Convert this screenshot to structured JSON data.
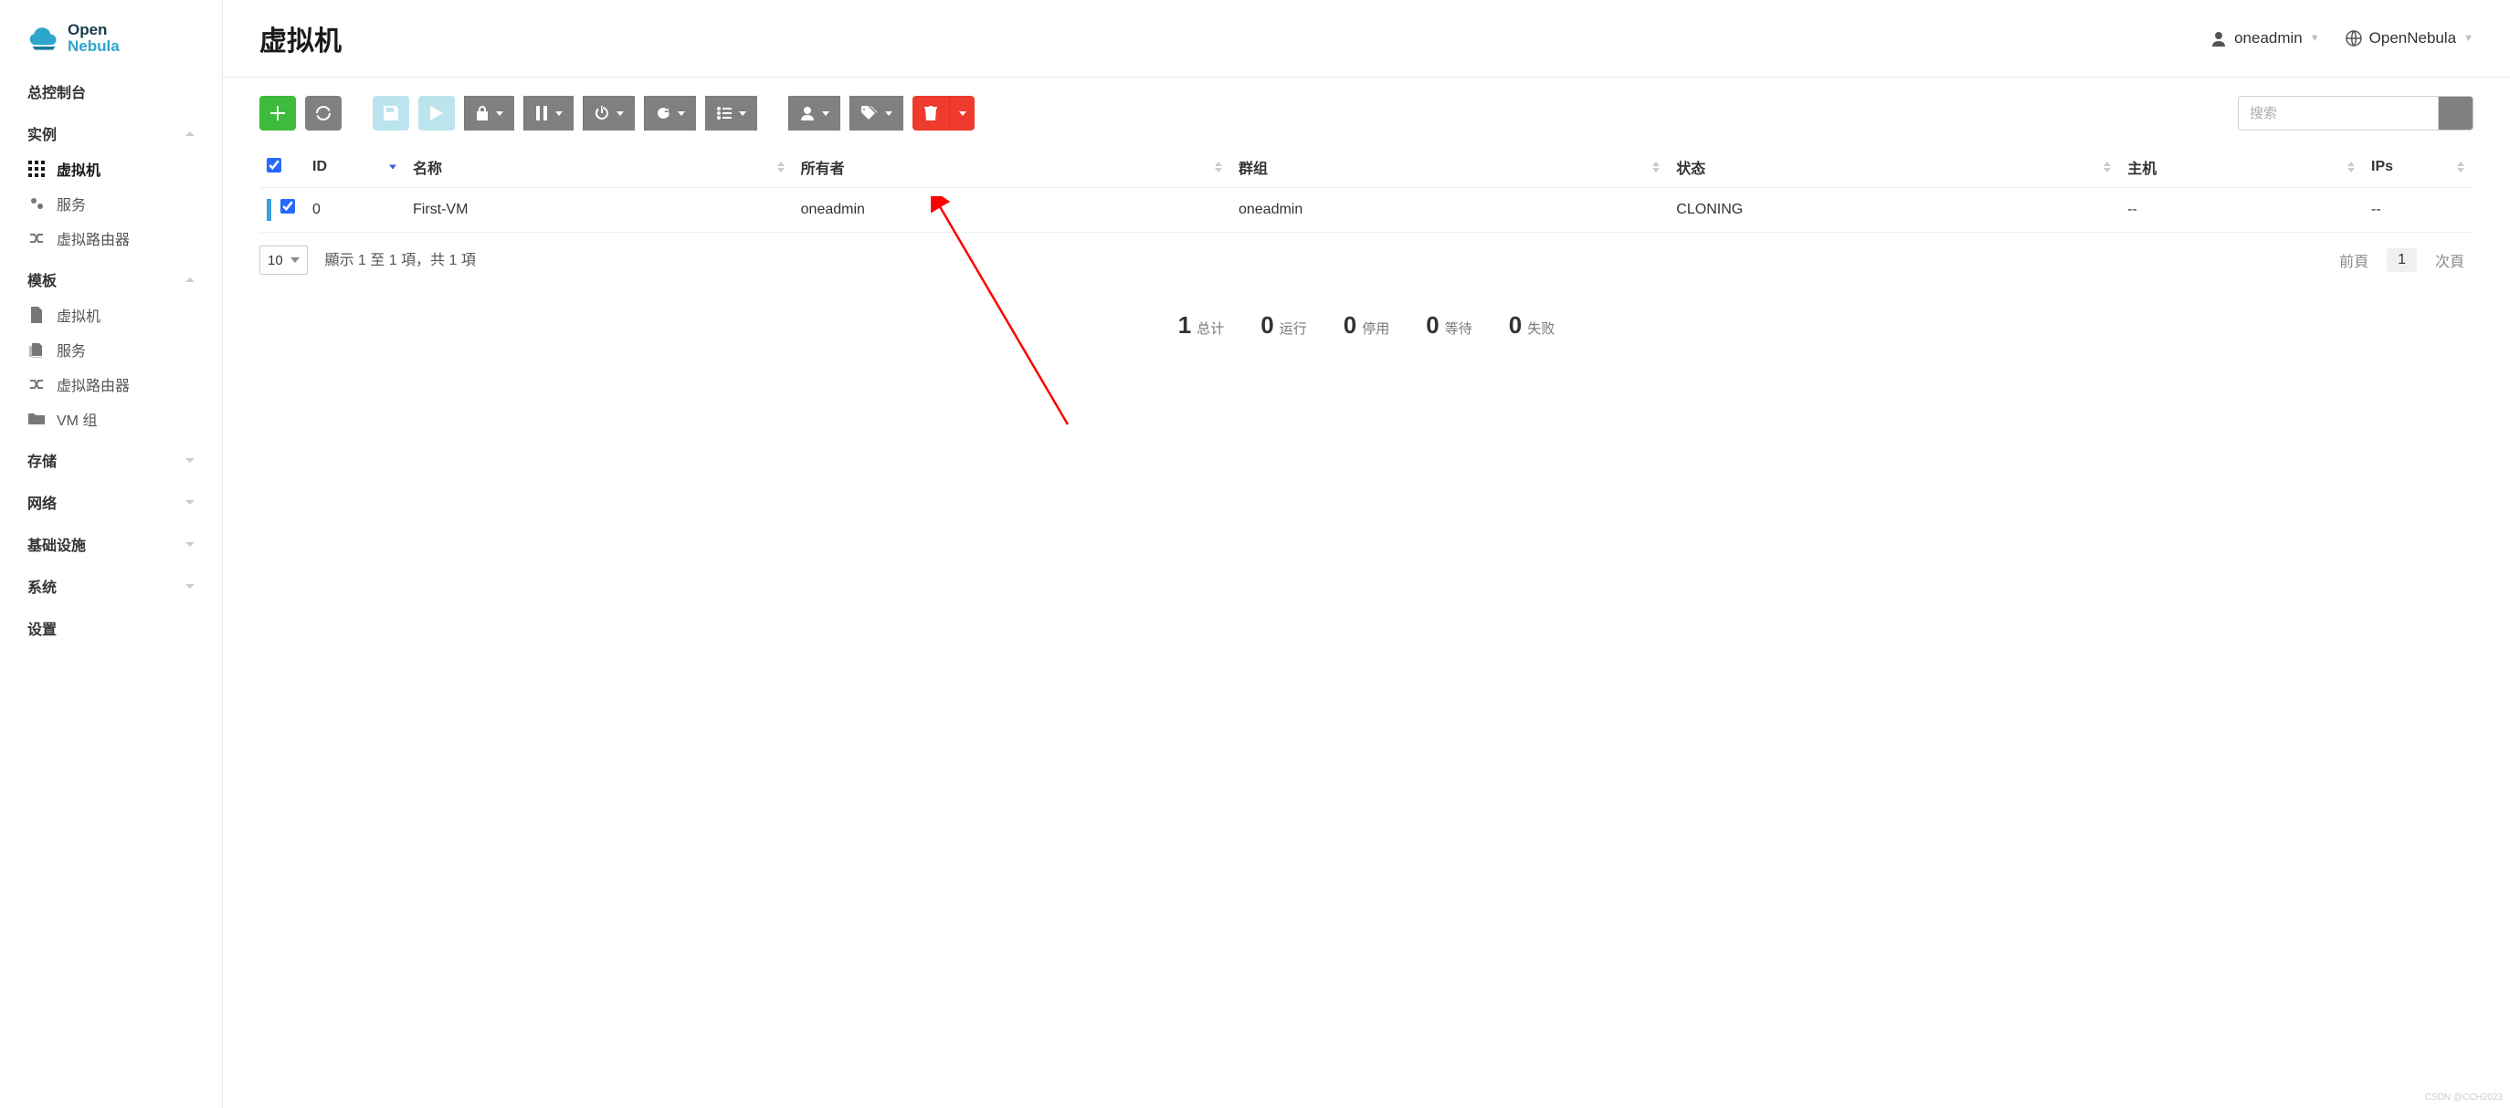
{
  "brand": {
    "top": "Open",
    "bottom": "Nebula"
  },
  "sidebar": {
    "dashboard": "总控制台",
    "instances_header": "实例",
    "vms": "虚拟机",
    "services": "服务",
    "vrouters": "虚拟路由器",
    "templates_header": "模板",
    "tmpl_vms": "虚拟机",
    "tmpl_services": "服务",
    "tmpl_vrouters": "虚拟路由器",
    "tmpl_vmgroups": "VM 组",
    "storage_header": "存储",
    "network_header": "网络",
    "infra_header": "基础设施",
    "system_header": "系统",
    "settings": "设置"
  },
  "header": {
    "title": "虚拟机",
    "user": "oneadmin",
    "zone": "OpenNebula"
  },
  "search": {
    "placeholder": "搜索"
  },
  "table": {
    "cols": {
      "id": "ID",
      "name": "名称",
      "owner": "所有者",
      "group": "群组",
      "status": "状态",
      "host": "主机",
      "ips": "IPs"
    },
    "rows": [
      {
        "id": "0",
        "name": "First-VM",
        "owner": "oneadmin",
        "group": "oneadmin",
        "status": "CLONING",
        "host": "--",
        "ips": "--"
      }
    ]
  },
  "pager": {
    "page_size": "10",
    "info": "顯示 1 至 1 項，共 1 項",
    "prev": "前頁",
    "current": "1",
    "next": "次頁"
  },
  "stats": {
    "total": {
      "num": "1",
      "label": "总计"
    },
    "running": {
      "num": "0",
      "label": "运行"
    },
    "stopped": {
      "num": "0",
      "label": "停用"
    },
    "pending": {
      "num": "0",
      "label": "等待"
    },
    "failed": {
      "num": "0",
      "label": "失败"
    }
  },
  "watermark": "CSDN @CCH2023"
}
